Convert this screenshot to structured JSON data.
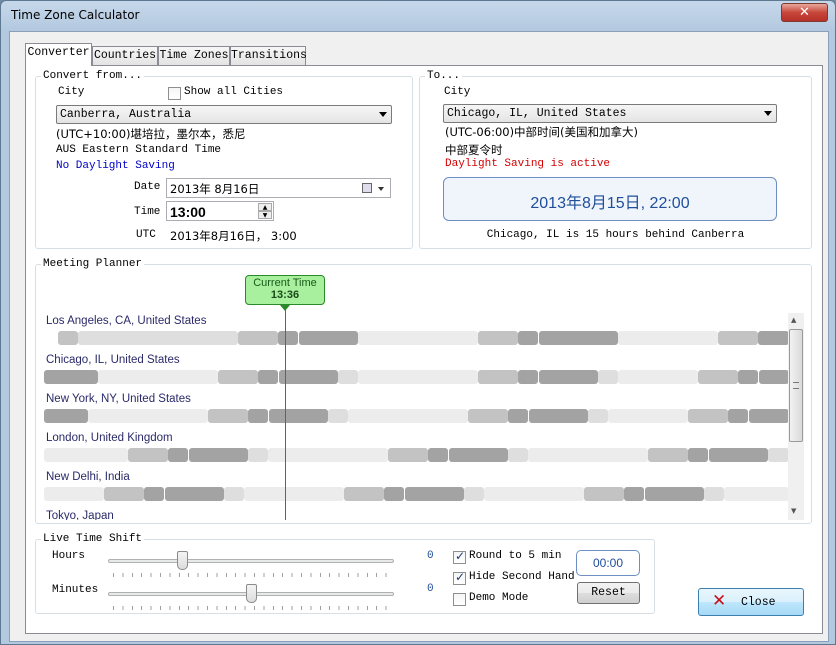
{
  "window": {
    "title": "Time Zone Calculator",
    "close_glyph": "✕"
  },
  "tabs": [
    "Converter",
    "Countries",
    "Time Zones",
    "Transitions"
  ],
  "convert_from": {
    "group_label": "Convert from...",
    "city_label": "City",
    "show_all_label": "Show all Cities",
    "show_all_checked": false,
    "city_value": "Canberra, Australia",
    "utc_name": "(UTC+10:00)堪培拉，墨尔本，悉尼",
    "standard_name": "AUS Eastern Standard Time",
    "daylight_status": "No Daylight Saving",
    "date_label": "Date",
    "date_value": "2013年  8月16日",
    "time_label": "Time",
    "time_value": "13:00",
    "utc_label": "UTC",
    "utc_value": "2013年8月16日， 3:00"
  },
  "convert_to": {
    "group_label": "To...",
    "city_label": "City",
    "city_value": "Chicago, IL, United States",
    "utc_name": "(UTC-06:00)中部时间(美国和加拿大)",
    "dst_name": "中部夏令时",
    "daylight_status": "Daylight Saving is active",
    "result_datetime": "2013年8月15日, 22:00",
    "difference_text": "Chicago, IL is 15 hours behind Canberra"
  },
  "meeting_planner": {
    "group_label": "Meeting Planner",
    "current_time_label": "Current Time",
    "current_time_value": "13:36",
    "cities": [
      "Los Angeles, CA, United States",
      "Chicago, IL, United States",
      "New York, NY, United States",
      "London, United Kingdom",
      "New Delhi, India",
      "Tokyo, Japan"
    ]
  },
  "live_shift": {
    "group_label": "Live Time Shift",
    "hours_label": "Hours",
    "hours_value": "0",
    "minutes_label": "Minutes",
    "minutes_value": "0",
    "round_label": "Round to 5 min",
    "round_checked": true,
    "hide_second_label": "Hide Second Hand",
    "hide_second_checked": true,
    "demo_label": "Demo Mode",
    "demo_checked": false,
    "offset_display": "00:00",
    "reset_label": "Reset"
  },
  "close_button_label": "Close",
  "colors": {
    "accent_blue": "#1f4e9a",
    "daylight_red": "#d40000",
    "no_daylight_blue": "#0000c8",
    "current_time_green": "#2a8a2a",
    "result_box_bg": "#f0f4fb"
  }
}
